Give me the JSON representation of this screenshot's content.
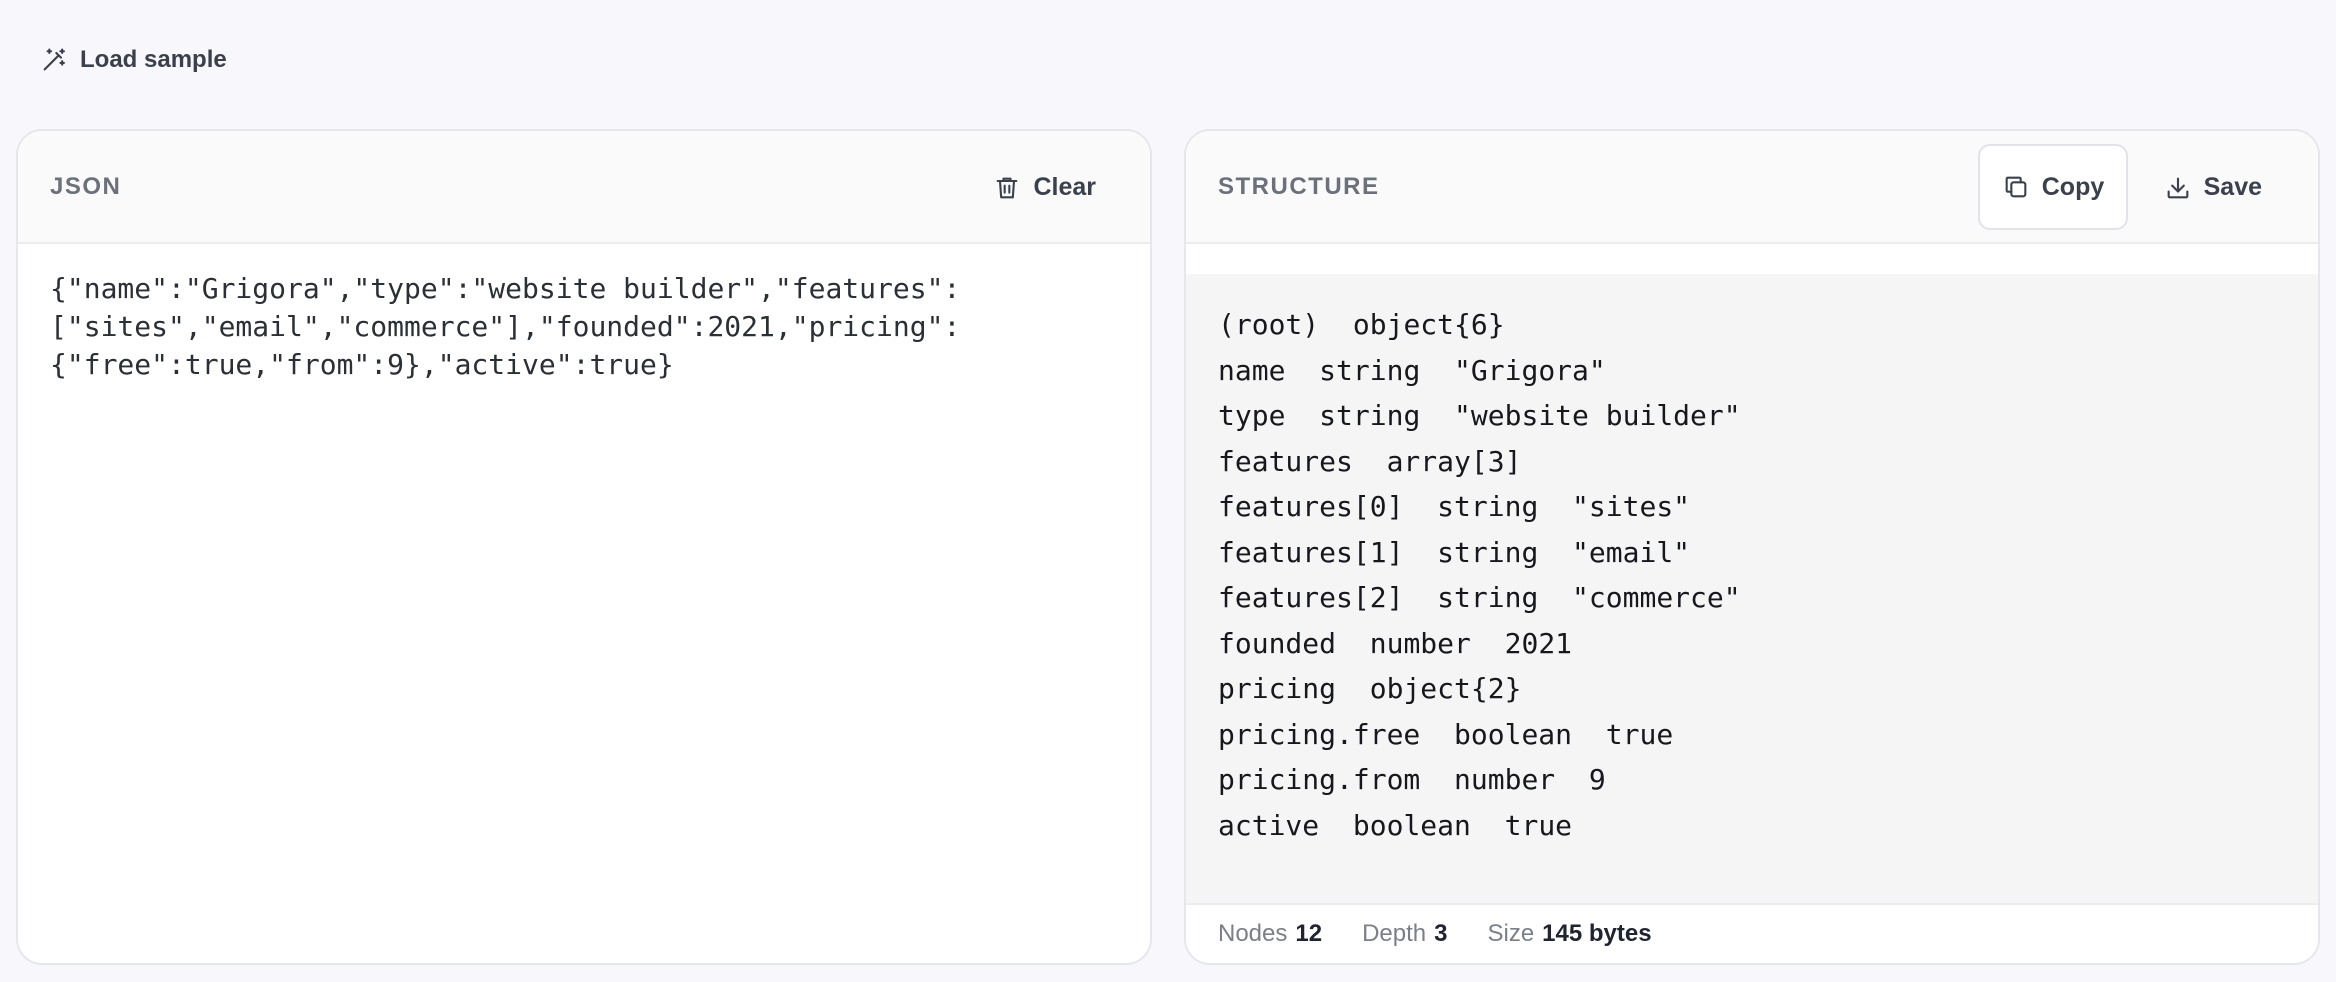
{
  "toolbar": {
    "load_sample_label": "Load sample",
    "load_sample_icon": "magic-wand-icon"
  },
  "json_panel": {
    "title": "JSON",
    "clear_label": "Clear",
    "clear_icon": "trash-icon",
    "content": "{\"name\":\"Grigora\",\"type\":\"website builder\",\"features\":[\"sites\",\"email\",\"commerce\"],\"founded\":2021,\"pricing\":{\"free\":true,\"from\":9},\"active\":true}"
  },
  "structure_panel": {
    "title": "STRUCTURE",
    "copy_label": "Copy",
    "copy_icon": "copy-icon",
    "save_label": "Save",
    "save_icon": "download-icon",
    "rows": [
      {
        "path": "(root)",
        "type": "object{6}",
        "value": ""
      },
      {
        "path": "name",
        "type": "string",
        "value": "\"Grigora\""
      },
      {
        "path": "type",
        "type": "string",
        "value": "\"website builder\""
      },
      {
        "path": "features",
        "type": "array[3]",
        "value": ""
      },
      {
        "path": "features[0]",
        "type": "string",
        "value": "\"sites\""
      },
      {
        "path": "features[1]",
        "type": "string",
        "value": "\"email\""
      },
      {
        "path": "features[2]",
        "type": "string",
        "value": "\"commerce\""
      },
      {
        "path": "founded",
        "type": "number",
        "value": "2021"
      },
      {
        "path": "pricing",
        "type": "object{2}",
        "value": ""
      },
      {
        "path": "pricing.free",
        "type": "boolean",
        "value": "true"
      },
      {
        "path": "pricing.from",
        "type": "number",
        "value": "9"
      },
      {
        "path": "active",
        "type": "boolean",
        "value": "true"
      }
    ],
    "stats": {
      "nodes_label": "Nodes",
      "nodes_value": "12",
      "depth_label": "Depth",
      "depth_value": "3",
      "size_label": "Size",
      "size_value": "145 bytes"
    }
  },
  "colors": {
    "page_background": "#f7f7fc",
    "panel_border": "#e6e7ec",
    "structure_background": "#f5f5f5",
    "muted_text": "#6b707b"
  }
}
